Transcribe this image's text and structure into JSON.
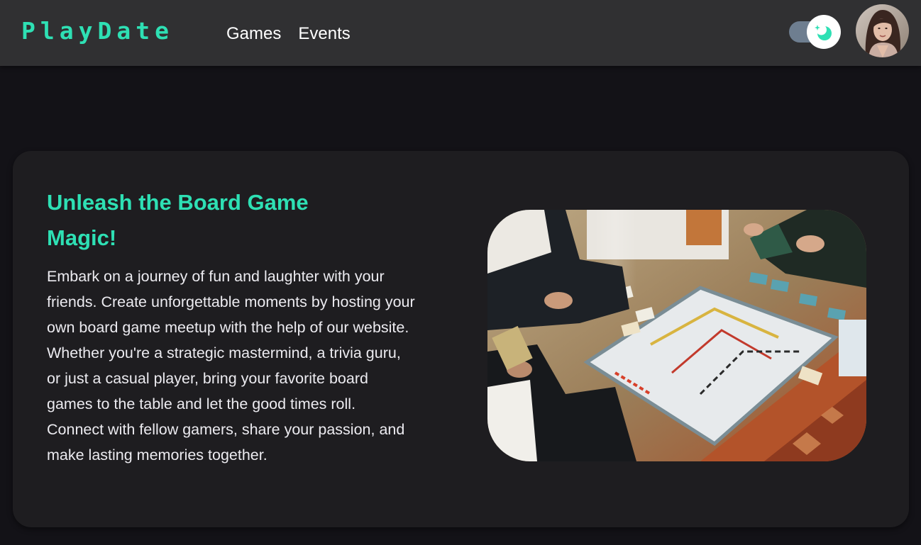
{
  "header": {
    "logo": "PlayDate",
    "nav": [
      {
        "label": "Games"
      },
      {
        "label": "Events"
      }
    ],
    "theme_toggle": {
      "state": "dark",
      "icon": "moon-sparkle-icon"
    },
    "avatar": {
      "icon": "user-avatar"
    }
  },
  "hero": {
    "title": "Unleash the Board Game Magic!",
    "body": "Embark on a journey of fun and laughter with your friends. Create unforgettable moments by hosting your own board game meetup with the help of our website. Whether you're a strategic mastermind, a trivia guru, or just a casual player, bring your favorite board games to the table and let the good times roll. Connect with fellow gamers, share your passion, and make lasting memories together.",
    "image": "board-game-photo"
  },
  "colors": {
    "accent": "#2ee0b4",
    "page_background": "#131217",
    "header_background": "#303032",
    "card_background": "#1e1d20",
    "text": "#ecebf0"
  }
}
